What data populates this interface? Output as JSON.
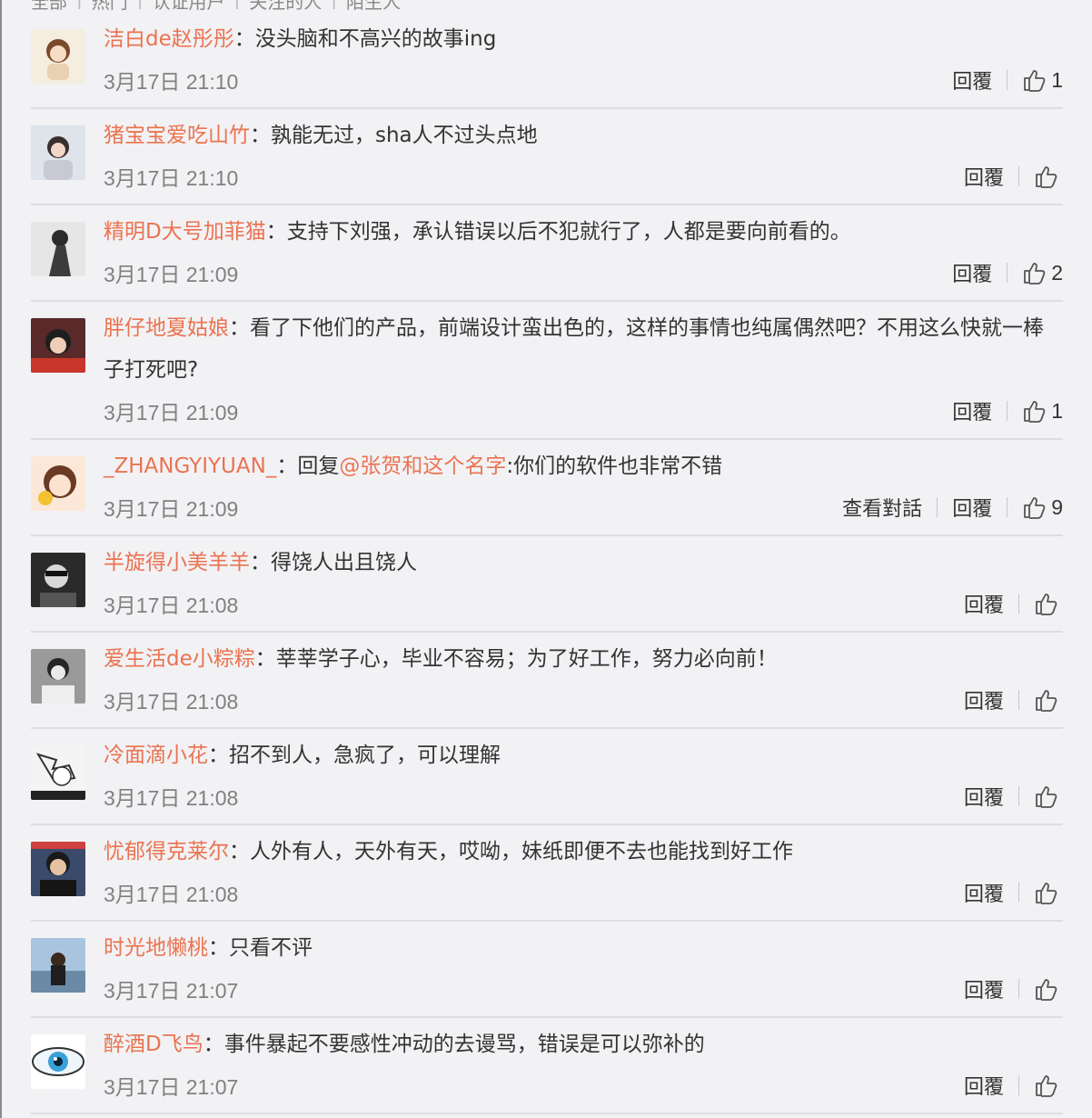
{
  "header_strip": [
    "全部",
    "热门",
    "认证用户",
    "关注的人",
    "陌生人"
  ],
  "comments": [
    {
      "user": "洁白de赵彤彤",
      "text": "没头脑和不高兴的故事ing",
      "time": "3月17日 21:10",
      "reply_label": "回覆",
      "likes": "1"
    },
    {
      "user": "猪宝宝爱吃山竹",
      "text": "孰能无过，sha人不过头点地",
      "time": "3月17日 21:10",
      "reply_label": "回覆",
      "likes": ""
    },
    {
      "user": "精明D大号加菲猫",
      "text": "支持下刘强，承认错误以后不犯就行了，人都是要向前看的。",
      "time": "3月17日 21:09",
      "reply_label": "回覆",
      "likes": "2"
    },
    {
      "user": "胖仔地夏姑娘",
      "text": "看了下他们的产品，前端设计蛮出色的，这样的事情也纯属偶然吧？不用这么快就一棒子打死吧?",
      "time": "3月17日 21:09",
      "reply_label": "回覆",
      "likes": "1"
    },
    {
      "user": "_ZHANGYIYUAN_",
      "text_prefix": "回复",
      "mention": "@张贺和这个名字",
      "text": ":你们的软件也非常不错",
      "time": "3月17日 21:09",
      "view_conversation_label": "查看對話",
      "reply_label": "回覆",
      "likes": "9"
    },
    {
      "user": "半旋得小美羊羊",
      "text": "得饶人出且饶人",
      "time": "3月17日 21:08",
      "reply_label": "回覆",
      "likes": ""
    },
    {
      "user": "爱生活de小粽粽",
      "text": "莘莘学子心，毕业不容易；为了好工作，努力必向前！",
      "time": "3月17日 21:08",
      "reply_label": "回覆",
      "likes": ""
    },
    {
      "user": "冷面滴小花",
      "text": "招不到人，急疯了，可以理解",
      "time": "3月17日 21:08",
      "reply_label": "回覆",
      "likes": ""
    },
    {
      "user": "忧郁得克莱尔",
      "text": "人外有人，天外有天，哎呦，妹纸即便不去也能找到好工作",
      "time": "3月17日 21:08",
      "reply_label": "回覆",
      "likes": ""
    },
    {
      "user": "时光地懒桃",
      "text": "只看不评",
      "time": "3月17日 21:07",
      "reply_label": "回覆",
      "likes": ""
    },
    {
      "user": "醉酒D飞鸟",
      "text": "事件暴起不要感性冲动的去谩骂，错误是可以弥补的",
      "time": "3月17日 21:07",
      "reply_label": "回覆",
      "likes": ""
    }
  ],
  "colors": {
    "username": "#eb7350",
    "text": "#333333",
    "time": "#808080",
    "background": "#f2f2f5",
    "divider": "#dedee2"
  },
  "icons": {
    "like": "thumbs-up-icon"
  }
}
